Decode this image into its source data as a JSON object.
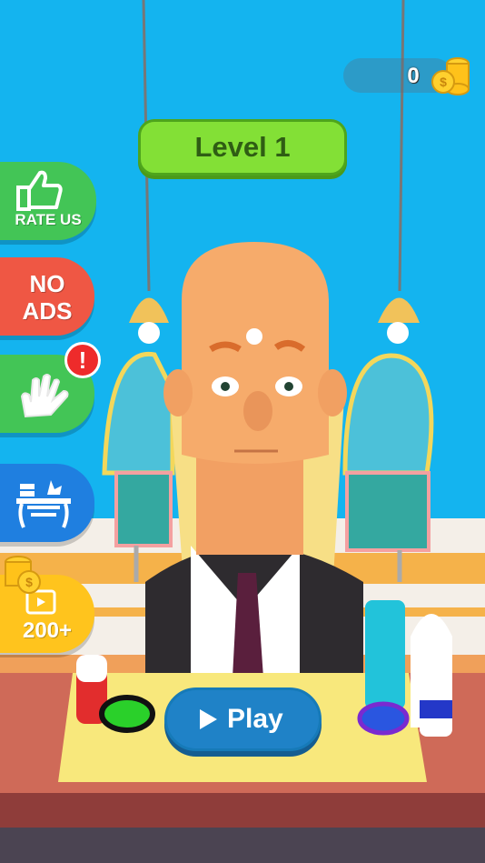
{
  "hud": {
    "coins": "0",
    "coin_icon": "coin-stack-icon"
  },
  "level": {
    "label": "Level 1"
  },
  "side_menu": {
    "rate_us": {
      "label": "RATE US",
      "icon": "thumbs-up-icon"
    },
    "no_ads": {
      "line1": "NO",
      "line2": "ADS"
    },
    "hand": {
      "icon": "hand-icon",
      "alert": "!"
    },
    "furniture": {
      "icon": "furniture-icon"
    },
    "reward": {
      "amount": "200+",
      "icon": "video-icon"
    }
  },
  "play_button": {
    "label": "Play",
    "icon": "play-icon"
  },
  "colors": {
    "sky": "#14b4ef",
    "green_button": "#43c556",
    "red_button": "#ef5744",
    "blue_button": "#1f7fe0",
    "yellow_button": "#ffc41d",
    "level_badge": "#83e036",
    "play_button": "#1f82c7"
  }
}
